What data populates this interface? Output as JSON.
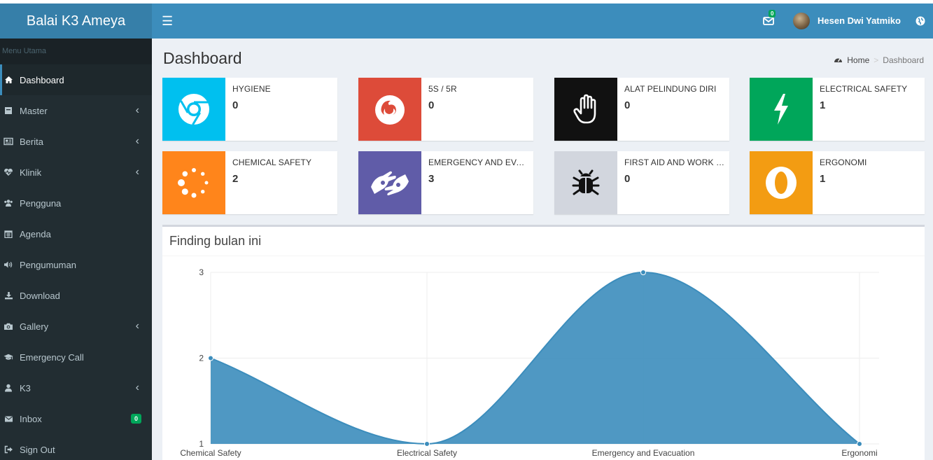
{
  "header": {
    "logo_text": "Balai K3 Ameya",
    "mail_count": "0",
    "username": "Hesen Dwi Yatmiko"
  },
  "sidebar": {
    "section_label": "Menu Utama",
    "items": [
      {
        "label": "Dashboard",
        "icon": "dashboard-icon",
        "chevron": false,
        "active": true
      },
      {
        "label": "Master",
        "icon": "table-icon",
        "chevron": true
      },
      {
        "label": "Berita",
        "icon": "newspaper-icon",
        "chevron": true
      },
      {
        "label": "Klinik",
        "icon": "heartbeat-icon",
        "chevron": true
      },
      {
        "label": "Pengguna",
        "icon": "users-icon",
        "chevron": false
      },
      {
        "label": "Agenda",
        "icon": "calendar-icon",
        "chevron": false
      },
      {
        "label": "Pengumuman",
        "icon": "volume-icon",
        "chevron": false
      },
      {
        "label": "Download",
        "icon": "download-icon",
        "chevron": false
      },
      {
        "label": "Gallery",
        "icon": "camera-icon",
        "chevron": true
      },
      {
        "label": "Emergency Call",
        "icon": "graduation-cap-icon",
        "chevron": false
      },
      {
        "label": "K3",
        "icon": "user-icon",
        "chevron": true
      },
      {
        "label": "Inbox",
        "icon": "envelope-icon",
        "chevron": false,
        "badge": "0"
      },
      {
        "label": "Sign Out",
        "icon": "sign-out-icon",
        "chevron": false
      }
    ]
  },
  "page": {
    "title": "Dashboard",
    "breadcrumb": [
      "Home",
      "Dashboard"
    ]
  },
  "info_boxes": [
    {
      "label": "HYGIENE",
      "value": "0",
      "color": "#00c0ef",
      "icon": "chrome-icon"
    },
    {
      "label": "5S / 5R",
      "value": "0",
      "color": "#dd4b39",
      "icon": "firefox-icon"
    },
    {
      "label": "ALAT PELINDUNG DIRI",
      "value": "0",
      "color": "#111111",
      "icon": "hand-icon"
    },
    {
      "label": "ELECTRICAL SAFETY",
      "value": "1",
      "color": "#00a65a",
      "icon": "bolt-icon"
    },
    {
      "label": "CHEMICAL SAFETY",
      "value": "2",
      "color": "#ff851b",
      "icon": "spinner-icon"
    },
    {
      "label": "EMERGENCY AND EVACUATION",
      "value": "3",
      "color": "#605ca8",
      "icon": "sign-language-icon"
    },
    {
      "label": "FIRST AID AND WORK ENVIRONMENT",
      "value": "0",
      "color": "#d2d6de",
      "icon": "bug-icon"
    },
    {
      "label": "ERGONOMI",
      "value": "1",
      "color": "#f39c12",
      "icon": "opera-icon"
    }
  ],
  "chart_box": {
    "title": "Finding bulan ini"
  },
  "chart_data": {
    "type": "area",
    "categories": [
      "Chemical Safety",
      "Electrical Safety",
      "Emergency and Evacuation",
      "Ergonomi"
    ],
    "values": [
      2,
      1,
      3,
      1
    ],
    "ylim": [
      1,
      3
    ],
    "yticks": [
      1,
      2,
      3
    ],
    "grid": true,
    "color": "#3c8dbc"
  }
}
